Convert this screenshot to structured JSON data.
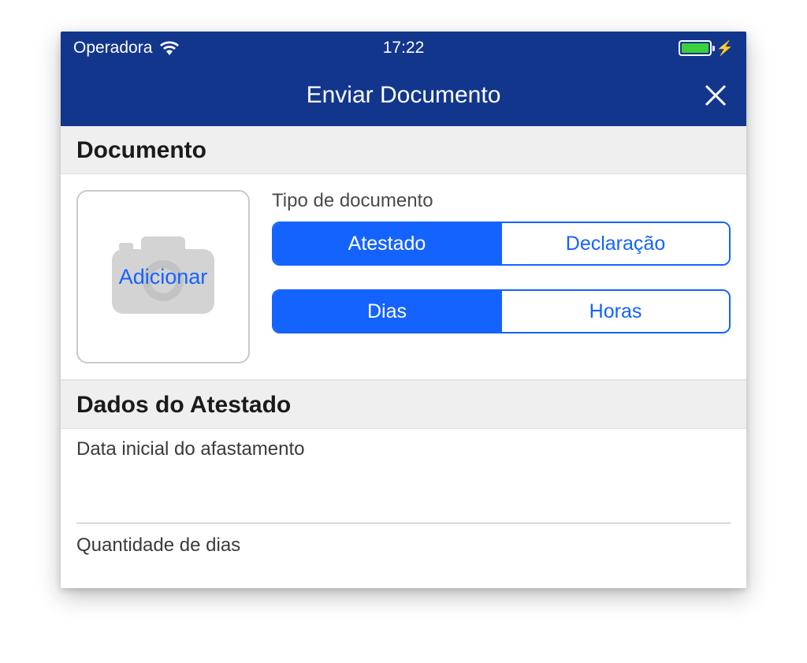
{
  "status": {
    "carrier": "Operadora",
    "time": "17:22"
  },
  "nav": {
    "title": "Enviar Documento"
  },
  "sections": {
    "documento": {
      "header": "Documento",
      "add_photo_label": "Adicionar",
      "tipo_label": "Tipo de documento",
      "tipo_options": {
        "option1": "Atestado",
        "option2": "Declaração"
      },
      "periodo_options": {
        "option1": "Dias",
        "option2": "Horas"
      }
    },
    "dados": {
      "header": "Dados do Atestado",
      "data_inicial_label": "Data inicial do afastamento",
      "quantidade_label": "Quantidade de dias"
    }
  }
}
